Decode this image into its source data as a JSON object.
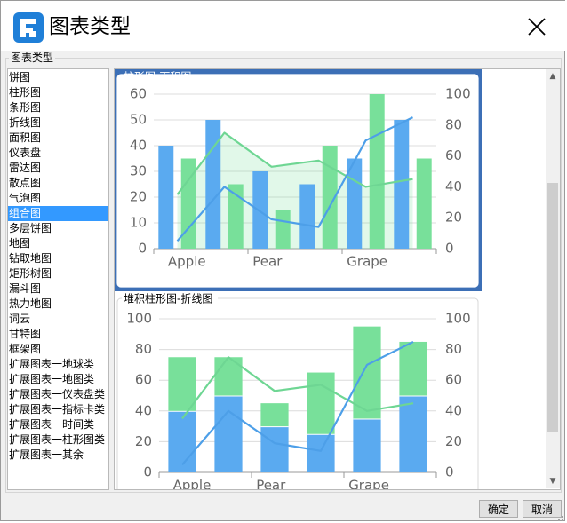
{
  "window": {
    "title": "图表类型",
    "group_label": "图表类型"
  },
  "type_list": [
    {
      "label": "饼图"
    },
    {
      "label": "柱形图"
    },
    {
      "label": "条形图"
    },
    {
      "label": "折线图"
    },
    {
      "label": "面积图"
    },
    {
      "label": "仪表盘"
    },
    {
      "label": "雷达图"
    },
    {
      "label": "散点图"
    },
    {
      "label": "气泡图"
    },
    {
      "label": "组合图",
      "selected": true
    },
    {
      "label": "多层饼图"
    },
    {
      "label": "地图"
    },
    {
      "label": "钻取地图"
    },
    {
      "label": "矩形树图"
    },
    {
      "label": "漏斗图"
    },
    {
      "label": "热力地图"
    },
    {
      "label": "词云"
    },
    {
      "label": "甘特图"
    },
    {
      "label": "框架图"
    },
    {
      "label": "扩展图表一地球类"
    },
    {
      "label": "扩展图表一地图类"
    },
    {
      "label": "扩展图表一仪表盘类"
    },
    {
      "label": "扩展图表一指标卡类"
    },
    {
      "label": "扩展图表一时间类"
    },
    {
      "label": "扩展图表一柱形图类"
    },
    {
      "label": "扩展图表一其余"
    }
  ],
  "colors": {
    "selection": "#3399ff",
    "preview_selected_border": "#3c6fb6",
    "bar_blue": "#5aaaf0",
    "bar_green": "#78e09a",
    "line_blue": "#4d9fe8",
    "line_green": "#6ed693"
  },
  "previews": [
    {
      "label": "柱形图-面积图",
      "selected": true,
      "chart_data": {
        "type": "bar",
        "categories": [
          "Apple",
          "",
          "Pear",
          "",
          "Grape",
          ""
        ],
        "series": [
          {
            "type": "bar",
            "axis": "left",
            "values": [
              40,
              50,
              30,
              25,
              35,
              50
            ]
          },
          {
            "type": "bar",
            "axis": "left",
            "values": [
              35,
              25,
              15,
              40,
              60,
              35
            ]
          },
          {
            "type": "area",
            "axis": "right",
            "values": [
              35,
              75,
              53,
              57,
              40,
              45
            ]
          },
          {
            "type": "line",
            "axis": "right",
            "values": [
              5,
              40,
              19,
              14,
              70,
              85
            ]
          }
        ],
        "left_ticks": [
          "0",
          "10",
          "20",
          "30",
          "40",
          "50",
          "60"
        ],
        "right_ticks": [
          "0",
          "20",
          "40",
          "60",
          "80",
          "100"
        ],
        "ylim_left": [
          0,
          60
        ],
        "ylim_right": [
          0,
          100
        ]
      }
    },
    {
      "label": "堆积柱形图-折线图",
      "selected": false,
      "chart_data": {
        "type": "bar",
        "stacked": true,
        "categories": [
          "Apple",
          "",
          "Pear",
          "",
          "Grape",
          ""
        ],
        "series": [
          {
            "type": "bar",
            "axis": "left",
            "values": [
              40,
              50,
              30,
              25,
              35,
              50
            ]
          },
          {
            "type": "bar",
            "axis": "left",
            "values": [
              35,
              25,
              15,
              40,
              60,
              35
            ]
          },
          {
            "type": "line",
            "axis": "right",
            "values": [
              35,
              75,
              53,
              57,
              40,
              45
            ]
          },
          {
            "type": "line",
            "axis": "right",
            "values": [
              5,
              40,
              19,
              14,
              70,
              85
            ]
          }
        ],
        "left_ticks": [
          "0",
          "20",
          "40",
          "60",
          "80",
          "100"
        ],
        "right_ticks": [
          "0",
          "20",
          "40",
          "60",
          "80",
          "100"
        ],
        "ylim_left": [
          0,
          100
        ],
        "ylim_right": [
          0,
          100
        ]
      }
    }
  ],
  "buttons": {
    "ok": "确定",
    "cancel": "取消"
  }
}
